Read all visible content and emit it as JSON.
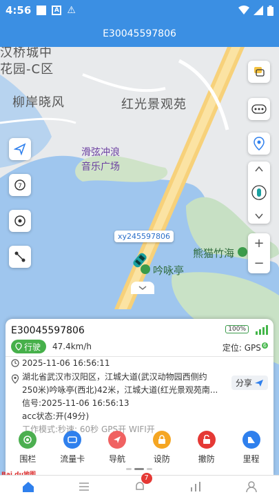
{
  "status_bar": {
    "time": "4:56"
  },
  "title_bar": {
    "title": "E30045597806"
  },
  "map": {
    "labels": {
      "district_top": "汉桥城中",
      "garden": "花园-C区",
      "liuan": "柳岸晓风",
      "hongguang": "红光景观苑",
      "music_square_1": "滑弦冲浪",
      "music_square_2": "音乐广场",
      "panda": "熊猫竹海",
      "yinyong": "吟咏亭"
    },
    "vehicle_tag": "xy245597806"
  },
  "card": {
    "device_id": "E30045597806",
    "battery": "100%",
    "state": "行驶",
    "speed": "47.4km/h",
    "positioning": "定位: GPS",
    "gps_badge": "6",
    "time": "2025-11-06 16:56:11",
    "address_line1": "湖北省武汉市汉阳区，江城大道(武汉动物园西侧约",
    "address_line2": "250米)吟咏亭(西北)42米，江城大道(红光景观苑南...",
    "signal": "信号:2025-11-06 16:56:13",
    "acc": "acc状态:开(49分)",
    "work_mode": "工作模式:秒速: 60秒 GPS开 WIFI开",
    "share_label": "分享",
    "actions": [
      {
        "label": "围栏",
        "color": "#4caf50"
      },
      {
        "label": "流量卡",
        "color": "#2f80ed"
      },
      {
        "label": "导航",
        "color": "#f06262"
      },
      {
        "label": "设防",
        "color": "#f5a623"
      },
      {
        "label": "撤防",
        "color": "#e53935"
      },
      {
        "label": "里程",
        "color": "#2f80ed"
      }
    ]
  },
  "bottom_nav": {
    "alerts_badge": "7"
  },
  "baidu_logo": "Bai du地图"
}
